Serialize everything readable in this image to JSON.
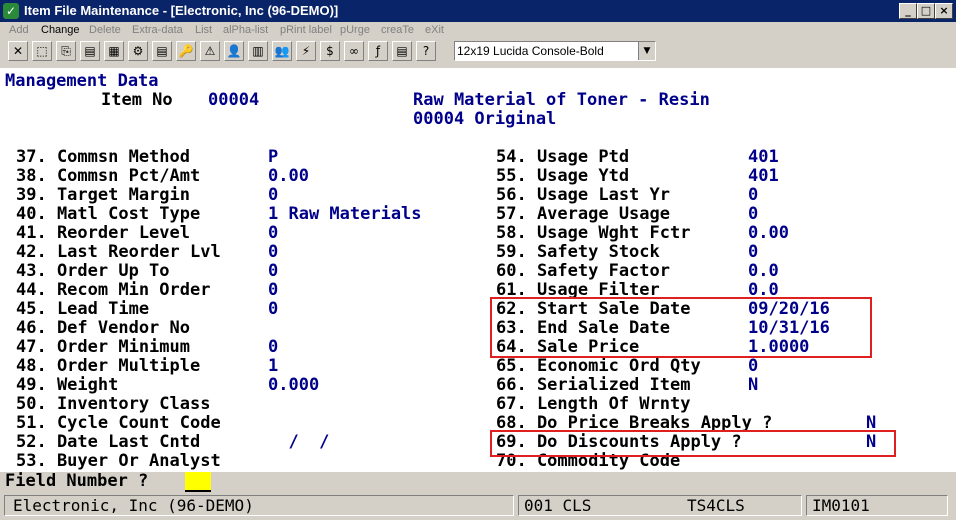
{
  "window": {
    "title": "Item File Maintenance - [Electronic, Inc (96-DEMO)]",
    "buttons": [
      "_",
      "□",
      "×"
    ]
  },
  "menu": [
    "Add",
    "Change",
    "Delete",
    "Extra-data",
    "List",
    "alPha-list",
    "pRint label",
    "pUrge",
    "creaTe",
    "eXit"
  ],
  "toolbar": {
    "icons": [
      "delete-icon",
      "select-icon",
      "copy-icon",
      "paste-icon",
      "grid-icon",
      "settings-icon",
      "note-icon",
      "key-icon",
      "warning-icon",
      "user-icon",
      "calendar-icon",
      "people-icon",
      "flash-icon",
      "dollar-icon",
      "link-icon",
      "function-icon",
      "document-icon",
      "help-icon"
    ],
    "glyphs": [
      "✕",
      "⬚",
      "⎘",
      "▤",
      "▦",
      "⚙",
      "▤",
      "🔑",
      "⚠",
      "👤",
      "▥",
      "👥",
      "⚡",
      "$",
      "∞",
      "ƒ",
      "▤",
      "?"
    ],
    "font_select": "12x19 Lucida Console-Bold"
  },
  "header": {
    "section": "Management Data",
    "item_label": "Item No",
    "item_no": "00004",
    "desc1": "Raw Material of Toner - Resin",
    "desc2": "00004 Original"
  },
  "left_fields": [
    {
      "label": "37. Commsn Method",
      "value": "P"
    },
    {
      "label": "38. Commsn Pct/Amt",
      "value": "0.00"
    },
    {
      "label": "39. Target Margin",
      "value": "0"
    },
    {
      "label": "40. Matl Cost Type",
      "value": "1 Raw Materials"
    },
    {
      "label": "41. Reorder Level",
      "value": "0"
    },
    {
      "label": "42. Last Reorder Lvl",
      "value": "0"
    },
    {
      "label": "43. Order Up To",
      "value": "0"
    },
    {
      "label": "44. Recom Min Order",
      "value": "0"
    },
    {
      "label": "45. Lead Time",
      "value": "0"
    },
    {
      "label": "46. Def Vendor No",
      "value": ""
    },
    {
      "label": "47. Order Minimum",
      "value": "0"
    },
    {
      "label": "48. Order Multiple",
      "value": "1"
    },
    {
      "label": "49. Weight",
      "value": "0.000"
    },
    {
      "label": "50. Inventory Class",
      "value": ""
    },
    {
      "label": "51. Cycle Count Code",
      "value": ""
    },
    {
      "label": "52. Date Last Cntd",
      "value": "  /  /"
    },
    {
      "label": "53. Buyer Or Analyst",
      "value": ""
    }
  ],
  "right_fields": [
    {
      "label": "54. Usage Ptd",
      "value": "401"
    },
    {
      "label": "55. Usage Ytd",
      "value": "401"
    },
    {
      "label": "56. Usage Last Yr",
      "value": "0"
    },
    {
      "label": "57. Average Usage",
      "value": "0"
    },
    {
      "label": "58. Usage Wght Fctr",
      "value": "0.00"
    },
    {
      "label": "59. Safety Stock",
      "value": "0"
    },
    {
      "label": "60. Safety Factor",
      "value": "0.0"
    },
    {
      "label": "61. Usage Filter",
      "value": "0.0"
    },
    {
      "label": "62. Start Sale Date",
      "value": "09/20/16"
    },
    {
      "label": "63. End Sale Date",
      "value": "10/31/16"
    },
    {
      "label": "64. Sale Price",
      "value": "1.0000"
    },
    {
      "label": "65. Economic Ord Qty",
      "value": "0"
    },
    {
      "label": "66. Serialized Item",
      "value": "N"
    },
    {
      "label": "67. Length Of Wrnty",
      "value": ""
    },
    {
      "label": "68. Do Price Breaks Apply ?",
      "value": "N"
    },
    {
      "label": "69. Do Discounts Apply ?",
      "value": "N"
    },
    {
      "label": "70. Commodity Code",
      "value": ""
    }
  ],
  "prompt": "Field Number ?",
  "status": {
    "company": "Electronic, Inc (96-DEMO)",
    "cls": "001 CLS",
    "terminal": "TS4CLS",
    "program": "IM0101"
  },
  "colors": {
    "title_bar": "#0a246a",
    "value_text": "#00008b",
    "highlight_box": "#e02020",
    "cursor": "#ffff00"
  }
}
